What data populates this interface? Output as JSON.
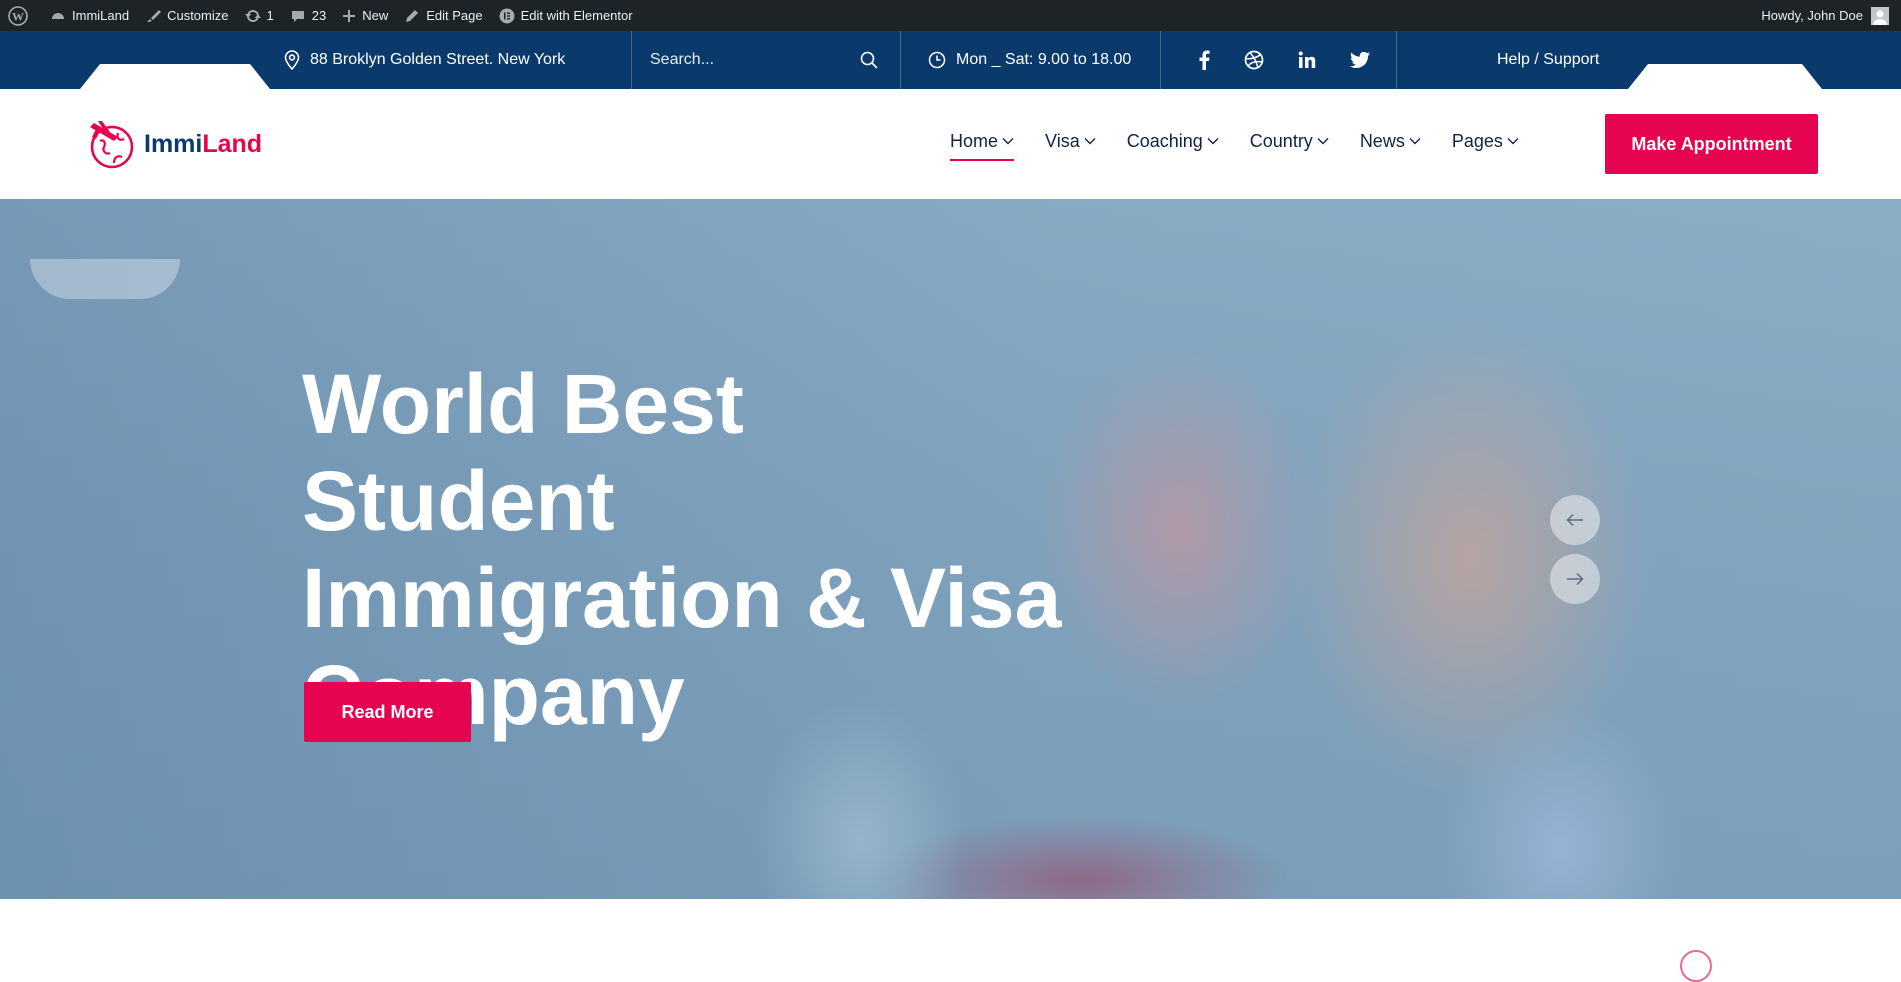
{
  "adminbar": {
    "site_name": "ImmiLand",
    "customize": "Customize",
    "updates_count": "1",
    "comments_count": "23",
    "new_label": "New",
    "edit_page": "Edit Page",
    "edit_elementor": "Edit with Elementor",
    "howdy": "Howdy, John Doe"
  },
  "topbar": {
    "address": "88 Broklyn Golden Street. New York",
    "search_placeholder": "Search...",
    "hours": "Mon _ Sat: 9.00 to 18.00",
    "help": "Help / Support",
    "social_icons": [
      "facebook-icon",
      "dribbble-icon",
      "linkedin-icon",
      "twitter-icon"
    ]
  },
  "header": {
    "logo_part1": "Immi",
    "logo_part2": "Land",
    "nav": [
      {
        "label": "Home",
        "active": true
      },
      {
        "label": "Visa"
      },
      {
        "label": "Coaching"
      },
      {
        "label": "Country"
      },
      {
        "label": "News"
      },
      {
        "label": "Pages"
      }
    ],
    "cta": "Make Appointment"
  },
  "hero": {
    "title_line1": "World Best Student",
    "title_line2": "Immigration & Visa",
    "title_line3": "Company",
    "button": "Read More"
  },
  "colors": {
    "brand_navy": "#0a3a6c",
    "brand_pink": "#e6034f",
    "adminbar_bg": "#1d2327"
  }
}
